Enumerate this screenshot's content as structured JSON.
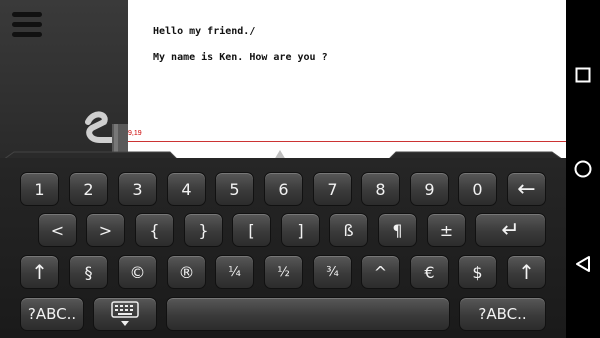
{
  "document": {
    "lines": [
      "Hello my friend./",
      "My name is Ken. How are you ?"
    ],
    "position_indicator": "9,19"
  },
  "keyboard": {
    "rows": [
      [
        "1",
        "2",
        "3",
        "4",
        "5",
        "6",
        "7",
        "8",
        "9",
        "0",
        "←"
      ],
      [
        "<",
        ">",
        "{",
        "}",
        "[",
        "]",
        "ß",
        "¶",
        "±",
        "↵"
      ],
      [
        "↑",
        "§",
        "©",
        "®",
        "¼",
        "½",
        "¾",
        "^",
        "€",
        "$",
        "↑"
      ],
      [
        "?ABC..",
        "⌨",
        "",
        "?ABC.."
      ]
    ]
  },
  "navbar": {
    "icons": [
      "recent-apps-icon",
      "home-icon",
      "back-icon"
    ]
  },
  "colors": {
    "accent": "#c33333",
    "key_text": "#f2f2f2",
    "paper": "#ffffff"
  }
}
